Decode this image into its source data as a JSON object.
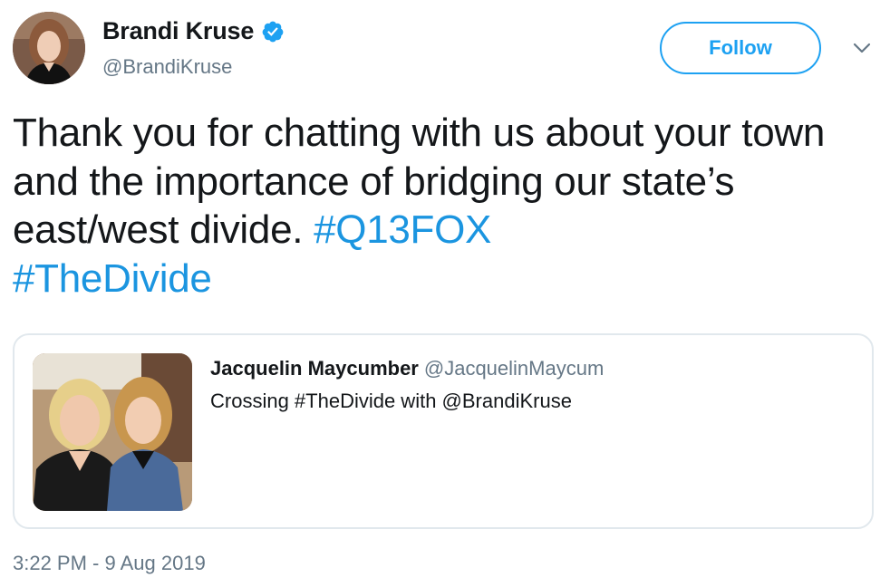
{
  "author": {
    "display_name": "Brandi Kruse",
    "handle": "@BrandiKruse",
    "verified": true,
    "avatar_icon": "profile-photo"
  },
  "actions": {
    "follow_label": "Follow",
    "more_icon": "chevron-down-icon"
  },
  "tweet": {
    "text_plain": "Thank you for chatting with us about your town and the importance of bridging our state’s east/west divide. ",
    "hashtags": [
      "#Q13FOX",
      "#TheDivide"
    ]
  },
  "quoted_tweet": {
    "display_name": "Jacquelin Maycumber",
    "handle": "@JacquelinMaycum",
    "text": "Crossing #TheDivide with @BrandiKruse",
    "photo_icon": "photo-two-women"
  },
  "timestamp": "3:22 PM - 9 Aug 2019",
  "colors": {
    "accent": "#1da1f2",
    "hashtag": "#1b95e0",
    "text": "#14171a",
    "secondary": "#657786",
    "border": "#e1e8ed"
  }
}
